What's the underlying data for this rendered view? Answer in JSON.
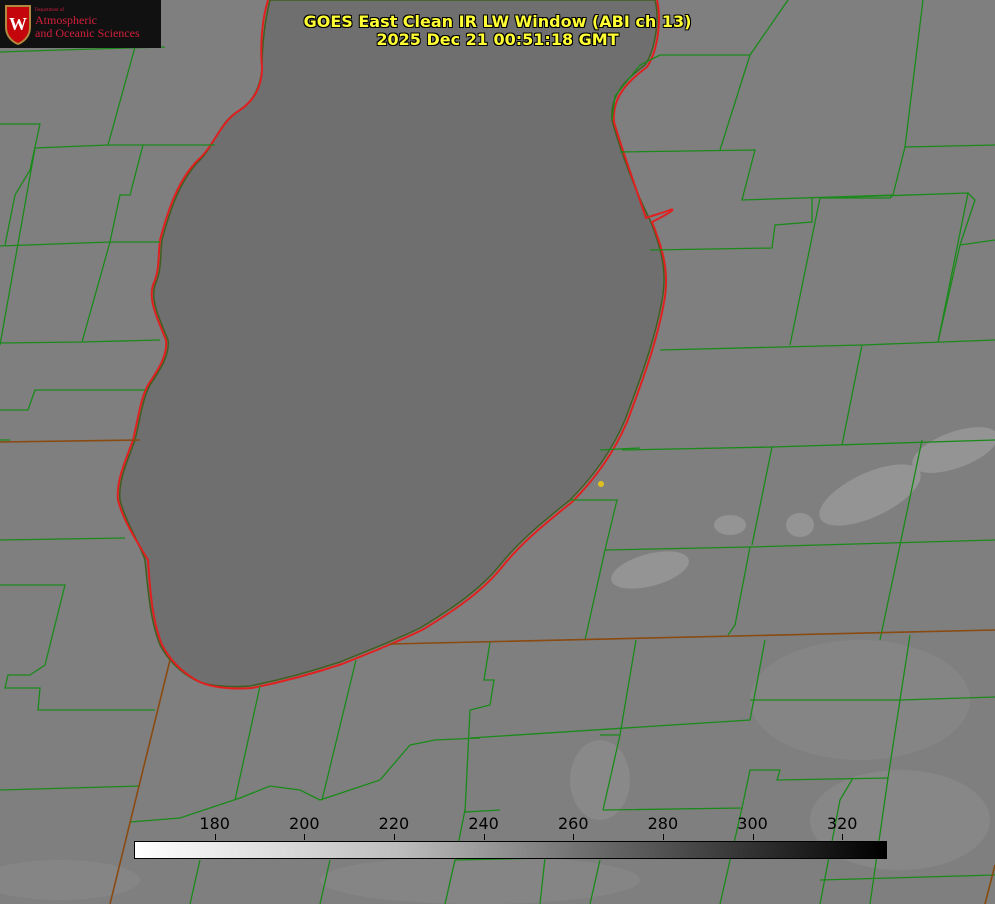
{
  "header": {
    "title_line1": "GOES East Clean IR LW Window (ABI ch 13)",
    "title_line2": "2025 Dec 21 00:51:18 GMT"
  },
  "logo": {
    "department_small": "Department of",
    "line1": "Atmospheric",
    "line2": "and Oceanic Sciences",
    "seal_letter": "W"
  },
  "colorbar": {
    "ticks": [
      "180",
      "200",
      "220",
      "240",
      "260",
      "280",
      "300",
      "320"
    ],
    "tick_values": [
      180,
      200,
      220,
      240,
      260,
      280,
      300,
      320
    ],
    "range": [
      162,
      330
    ],
    "gradient": "white-to-black"
  },
  "colors": {
    "county_lines": "#1a8a1a",
    "state_lines": "#8a4a10",
    "coastline": "#e02020",
    "lake_fill": "#6f6f6f",
    "land_fill": "#7f7f7f",
    "title_text": "#ffff33",
    "marker": "#e0c020"
  }
}
